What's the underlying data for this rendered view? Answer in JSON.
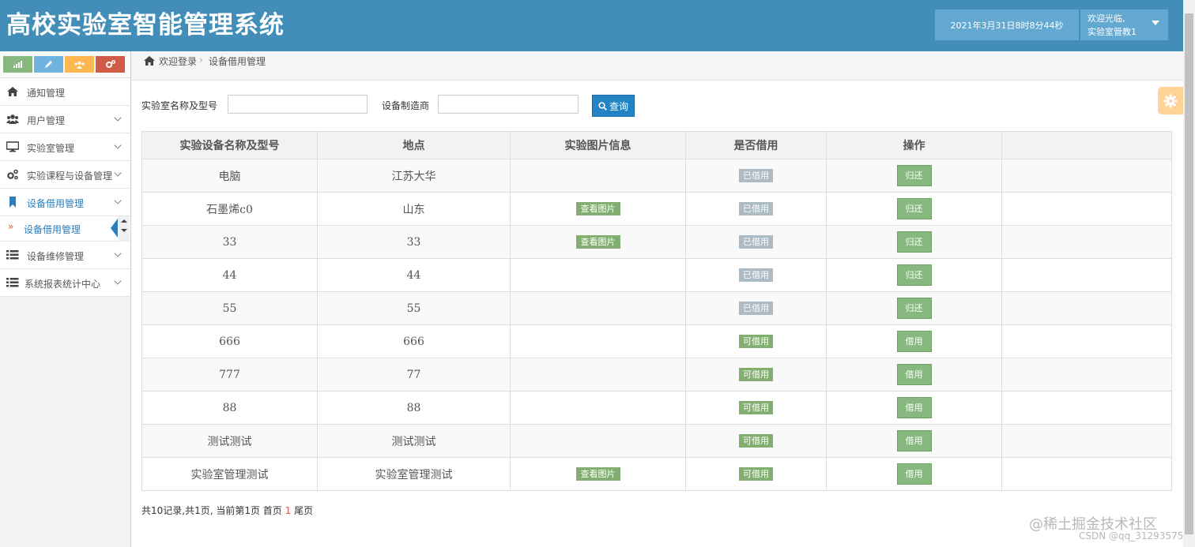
{
  "header": {
    "title": "高校实验室智能管理系统",
    "datetime": "2021年3月31日8时8分44秒",
    "welcome": "欢迎光临,",
    "user": "实验室管教1"
  },
  "sidebar": {
    "shortcut_colors": [
      "#87b87f",
      "#6fb3e0",
      "#ffb752",
      "#d15b47"
    ],
    "items": [
      {
        "label": "通知管理",
        "icon": "home-icon"
      },
      {
        "label": "用户管理",
        "icon": "users-icon"
      },
      {
        "label": "实验室管理",
        "icon": "desktop-icon"
      },
      {
        "label": "实验课程与设备管理",
        "icon": "cogs-icon"
      },
      {
        "label": "设备借用管理",
        "icon": "bookmark-icon"
      },
      {
        "label": "设备维修管理",
        "icon": "list-icon"
      },
      {
        "label": "系统报表统计中心",
        "icon": "list-icon"
      }
    ],
    "sub_item": "设备借用管理"
  },
  "breadcrumb": {
    "home": "欢迎登录",
    "current": "设备借用管理"
  },
  "search": {
    "name_label": "实验室名称及型号",
    "name_value": "",
    "maker_label": "设备制造商",
    "maker_value": "",
    "button": "查询"
  },
  "table": {
    "headers": [
      "实验设备名称及型号",
      "地点",
      "实验图片信息",
      "是否借用",
      "操作",
      ""
    ],
    "pic_label": "查看图片",
    "rows": [
      {
        "name": "电脑",
        "place": "江苏大华",
        "pic": false,
        "status": "已借用",
        "action": "归还"
      },
      {
        "name": "石墨烯c0",
        "place": "山东",
        "pic": true,
        "status": "已借用",
        "action": "归还"
      },
      {
        "name": "33",
        "place": "33",
        "pic": true,
        "status": "已借用",
        "action": "归还"
      },
      {
        "name": "44",
        "place": "44",
        "pic": false,
        "status": "已借用",
        "action": "归还"
      },
      {
        "name": "55",
        "place": "55",
        "pic": false,
        "status": "已借用",
        "action": "归还"
      },
      {
        "name": "666",
        "place": "666",
        "pic": false,
        "status": "可借用",
        "action": "借用"
      },
      {
        "name": "777",
        "place": "77",
        "pic": false,
        "status": "可借用",
        "action": "借用"
      },
      {
        "name": "88",
        "place": "88",
        "pic": false,
        "status": "可借用",
        "action": "借用"
      },
      {
        "name": "测试测试",
        "place": "测试测试",
        "pic": false,
        "status": "可借用",
        "action": "借用"
      },
      {
        "name": "实验室管理测试",
        "place": "实验室管理测试",
        "pic": true,
        "status": "可借用",
        "action": "借用"
      }
    ]
  },
  "pager": {
    "summary": "共10记录,共1页, 当前第1页 首页",
    "current": "1",
    "last": "尾页"
  },
  "watermark": {
    "line1": "@稀土掘金技术社区",
    "line2": "CSDN @qq_31293575"
  }
}
